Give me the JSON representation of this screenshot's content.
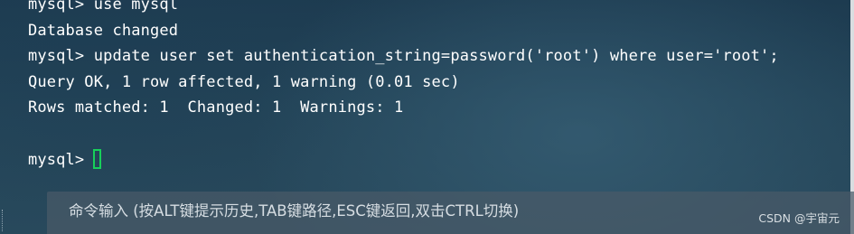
{
  "terminal": {
    "lines": [
      "mysql> use mysql",
      "Database changed",
      "mysql> update user set authentication_string=password('root') where user='root';",
      "Query OK, 1 row affected, 1 warning (0.01 sec)",
      "Rows matched: 1  Changed: 1  Warnings: 1",
      "",
      "mysql> "
    ],
    "cursor_color": "#17d05a",
    "text_color": "#ffffff"
  },
  "hint_bar": {
    "text": "命令输入 (按ALT键提示历史,TAB键路径,ESC键返回,双击CTRL切换)"
  },
  "watermark": {
    "text": "CSDN @宇宙元"
  }
}
